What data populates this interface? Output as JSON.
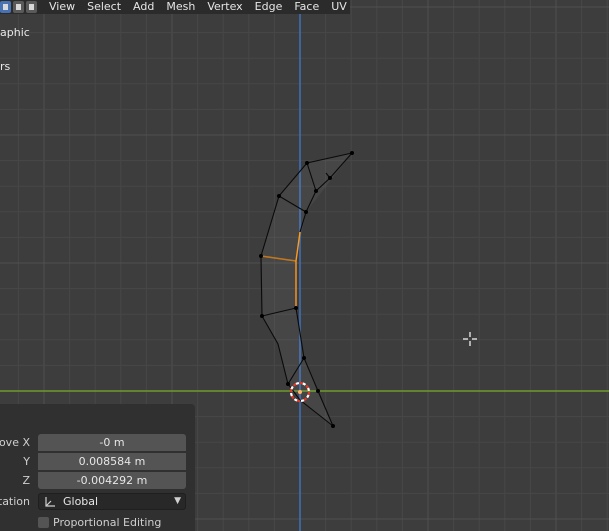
{
  "header": {
    "menu": [
      "View",
      "Select",
      "Add",
      "Mesh",
      "Vertex",
      "Edge",
      "Face",
      "UV"
    ]
  },
  "overlay": {
    "view_name": "aphic",
    "collection_name": "rs"
  },
  "operator_panel": {
    "move_x_label": "ove X",
    "move_x_value": "-0 m",
    "y_label": "Y",
    "y_value": "0.008584 m",
    "z_label": "Z",
    "z_value": "-0.004292 m",
    "orientation_label": "tation",
    "orientation_value": "Global",
    "proportional_editing_label": "Proportional Editing"
  },
  "colors": {
    "background": "#3d3d3d",
    "grid_line": "#474747",
    "grid_major": "#505050",
    "y_axis": "#3f6fb8",
    "x_axis": "#6f9b2b",
    "wire": "#0a0a0a",
    "selected_edge": "#ff9a1f",
    "cursor_red": "#e0392a"
  }
}
